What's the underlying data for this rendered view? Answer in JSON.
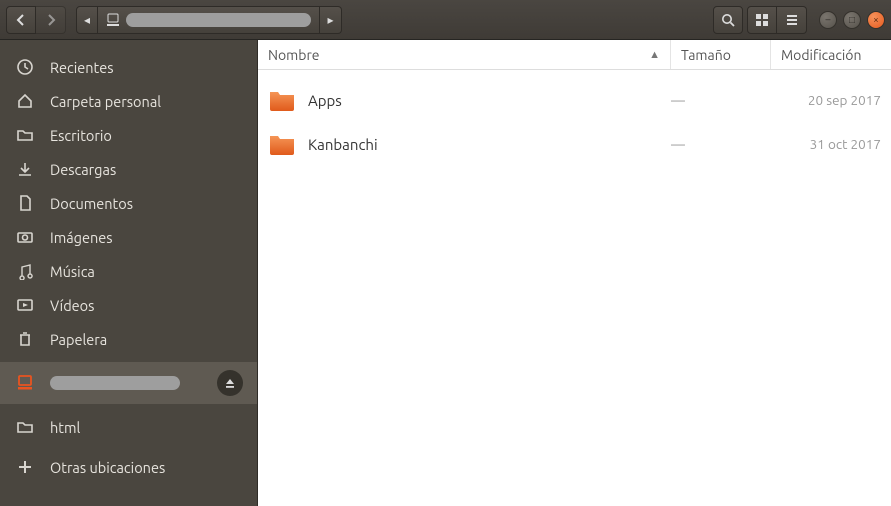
{
  "toolbar": {
    "back": "‹",
    "forward": "›",
    "path_prev": "◂",
    "path_next": "▸"
  },
  "window_controls": {
    "minimize": "–",
    "maximize": "□",
    "close": "×"
  },
  "sidebar": {
    "items": [
      {
        "label": "Recientes"
      },
      {
        "label": "Carpeta personal"
      },
      {
        "label": "Escritorio"
      },
      {
        "label": "Descargas"
      },
      {
        "label": "Documentos"
      },
      {
        "label": "Imágenes"
      },
      {
        "label": "Música"
      },
      {
        "label": "Vídeos"
      },
      {
        "label": "Papelera"
      }
    ],
    "mount_label_hidden": true,
    "bookmarks": [
      {
        "label": "html"
      }
    ],
    "other_locations": "Otras ubicaciones"
  },
  "columns": {
    "name": "Nombre",
    "size": "Tamaño",
    "modified": "Modificación"
  },
  "rows": [
    {
      "name": "Apps",
      "size": "—",
      "modified": "20 sep 2017"
    },
    {
      "name": "Kanbanchi",
      "size": "—",
      "modified": "31 oct 2017"
    }
  ]
}
